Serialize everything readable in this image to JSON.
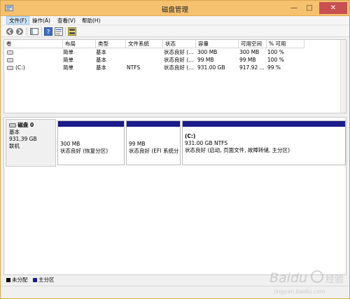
{
  "window": {
    "title": "磁盘管理"
  },
  "titlebar": {
    "minimize_icon": "minimize-icon",
    "maximize_icon": "maximize-icon",
    "close_icon": "close-icon"
  },
  "menu": [
    {
      "label": "文件(F)",
      "active": true
    },
    {
      "label": "操作(A)"
    },
    {
      "label": "查看(V)"
    },
    {
      "label": "帮助(H)"
    }
  ],
  "toolbar": {
    "buttons": [
      "back-arrow-icon",
      "forward-arrow-icon",
      "console-tree-icon",
      "help-icon",
      "properties-icon",
      "disk-settings-icon"
    ]
  },
  "volume_table": {
    "columns": [
      "卷",
      "布局",
      "类型",
      "文件系统",
      "状态",
      "容量",
      "可用空间",
      "% 可用"
    ],
    "rows": [
      [
        "",
        "简单",
        "基本",
        "",
        "状态良好 (...",
        "300 MB",
        "300 MB",
        "100 %"
      ],
      [
        "",
        "简单",
        "基本",
        "",
        "状态良好 (...",
        "99 MB",
        "99 MB",
        "100 %"
      ],
      [
        "(C:)",
        "简单",
        "基本",
        "NTFS",
        "状态良好 (...",
        "931.00 GB",
        "917.92 ...",
        "99 %"
      ]
    ]
  },
  "disk": {
    "name": "磁盘 0",
    "type": "基本",
    "size": "931.39 GB",
    "state": "联机",
    "partitions": [
      {
        "title": "",
        "line1": "300 MB",
        "line2": "状态良好 (恢复分区)"
      },
      {
        "title": "",
        "line1": "99 MB",
        "line2": "状态良好 (EFI 系统分"
      },
      {
        "title": "(C:)",
        "line1": "931.00 GB NTFS",
        "line2": "状态良好 (启动, 页面文件, 故障转储, 主分区)"
      }
    ]
  },
  "legend": [
    {
      "label": "未分配",
      "color": "#000000"
    },
    {
      "label": "主分区",
      "color": "#1b1b8a"
    }
  ],
  "watermark": {
    "text": "Baidu 经验",
    "url_text": "jingyan.baidu.com"
  }
}
